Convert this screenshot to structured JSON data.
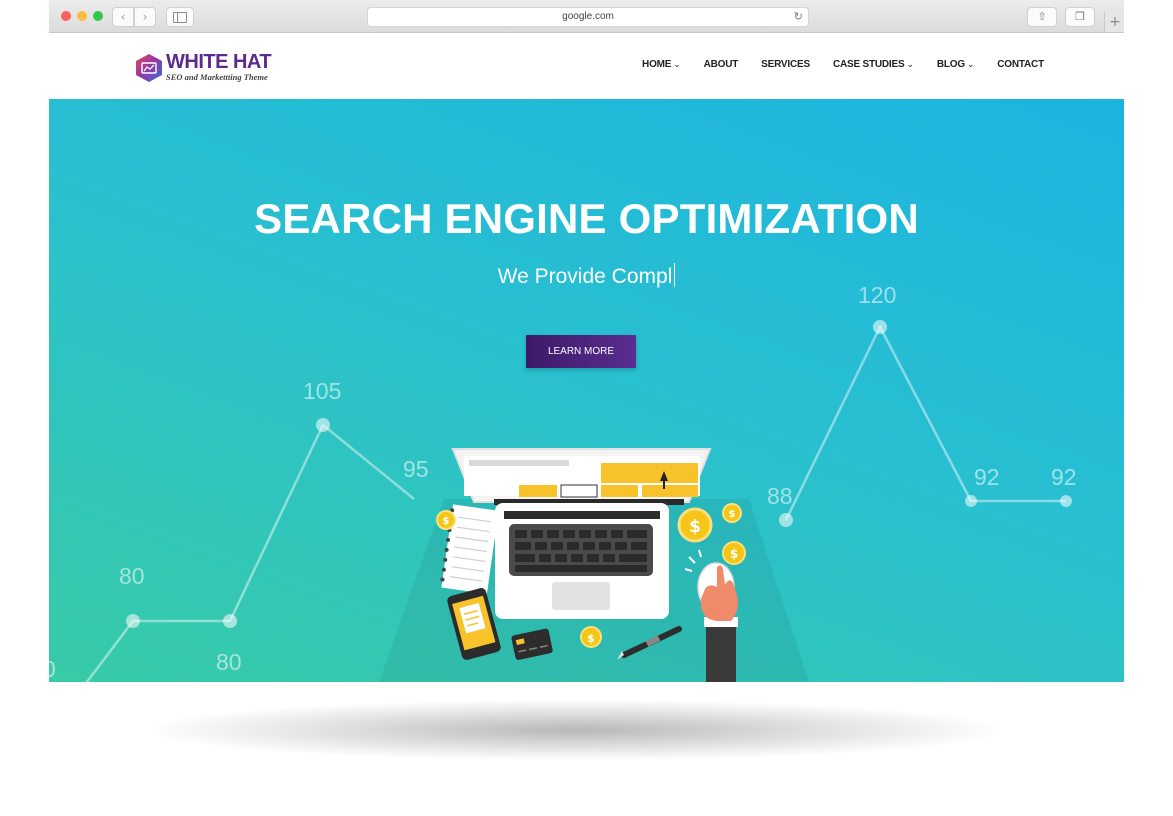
{
  "browser": {
    "url": "google.com",
    "buttons": {
      "back": "‹",
      "forward": "›",
      "reload": "↻",
      "share": "⇧",
      "tabs": "❐",
      "new_tab": "+"
    }
  },
  "site": {
    "logo": {
      "title": "WHITE HAT",
      "subtitle": "SEO and Markettting Theme"
    },
    "menu": [
      {
        "label": "HOME",
        "dropdown": true
      },
      {
        "label": "ABOUT",
        "dropdown": false
      },
      {
        "label": "SERVICES",
        "dropdown": false
      },
      {
        "label": "CASE STUDIES",
        "dropdown": true
      },
      {
        "label": "BLOG",
        "dropdown": true
      },
      {
        "label": "CONTACT",
        "dropdown": false
      }
    ],
    "chevron": "⌄"
  },
  "hero": {
    "title": "SEARCH ENGINE OPTIMIZATION",
    "typed_text": "We Provide Compl",
    "cta_label": "LEARN MORE",
    "graph_labels": [
      "0",
      "80",
      "80",
      "105",
      "95",
      "88",
      "120",
      "92",
      "92"
    ],
    "coin_symbol": "$"
  },
  "colors": {
    "accent": "#5b2b8a",
    "hero_top": "#1cb4df",
    "hero_bottom": "#38cba7",
    "cta": "#4a2278",
    "coin": "#f5c518"
  }
}
